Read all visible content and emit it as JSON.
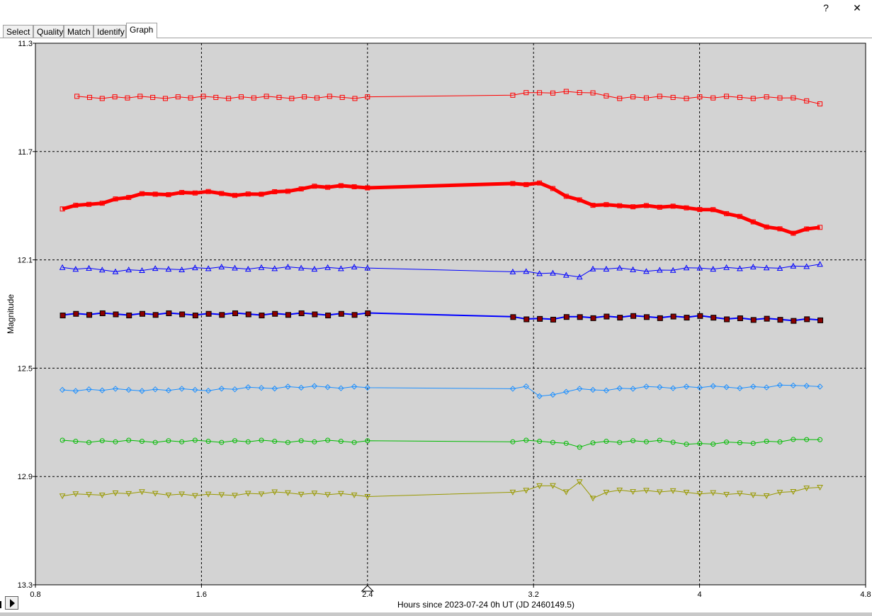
{
  "window": {
    "help_label": "?",
    "close_label": "✕"
  },
  "tabs": [
    {
      "label": "Select",
      "active": false
    },
    {
      "label": "Quality",
      "active": false
    },
    {
      "label": "Match",
      "active": false
    },
    {
      "label": "Identify",
      "active": false
    },
    {
      "label": "Graph",
      "active": true
    }
  ],
  "chart_data": {
    "type": "scatter",
    "xlabel": "Hours since 2023-07-24 0h UT (JD 2460149.5)",
    "ylabel": "Magnitude",
    "xlim": [
      0.8,
      4.8
    ],
    "ylim": [
      13.3,
      11.3
    ],
    "y_inverted": true,
    "xticks": [
      "0.8",
      "1.6",
      "2.4",
      "3.2",
      "4",
      "4.8"
    ],
    "yticks": [
      "11.3",
      "11.7",
      "12.1",
      "12.5",
      "12.9",
      "13.3"
    ],
    "grid": true,
    "plot_background": "#d3d3d3",
    "time_marker_x": 2.4,
    "gap": [
      2.4,
      3.1
    ],
    "series": [
      {
        "color": "#ff0000",
        "marker": "square",
        "line_width": 1,
        "points": 48,
        "keypoints": [
          [
            1.0,
            11.5
          ],
          [
            1.5,
            11.5
          ],
          [
            2.1,
            11.5
          ],
          [
            2.4,
            11.5
          ],
          [
            3.1,
            11.49
          ],
          [
            3.28,
            11.48
          ],
          [
            3.42,
            11.48
          ],
          [
            3.6,
            11.5
          ],
          [
            4.0,
            11.5
          ],
          [
            4.4,
            11.5
          ],
          [
            4.58,
            11.52
          ]
        ]
      },
      {
        "color": "#ff0000",
        "marker": "square",
        "line_width": 5,
        "points": 48,
        "keypoints": [
          [
            0.93,
            11.91
          ],
          [
            1.1,
            11.89
          ],
          [
            1.3,
            11.86
          ],
          [
            1.6,
            11.85
          ],
          [
            1.8,
            11.86
          ],
          [
            2.0,
            11.85
          ],
          [
            2.1,
            11.83
          ],
          [
            2.4,
            11.83
          ],
          [
            3.1,
            11.82
          ],
          [
            3.25,
            11.82
          ],
          [
            3.38,
            11.87
          ],
          [
            3.5,
            11.9
          ],
          [
            3.7,
            11.9
          ],
          [
            4.0,
            11.91
          ],
          [
            4.1,
            11.92
          ],
          [
            4.3,
            11.97
          ],
          [
            4.45,
            12.0
          ],
          [
            4.58,
            11.98
          ]
        ]
      },
      {
        "color": "#0000ff",
        "marker": "triangle-up",
        "line_width": 1,
        "points": 48,
        "keypoints": [
          [
            0.93,
            12.13
          ],
          [
            1.2,
            12.14
          ],
          [
            1.6,
            12.13
          ],
          [
            2.0,
            12.13
          ],
          [
            2.4,
            12.13
          ],
          [
            3.1,
            12.14
          ],
          [
            3.25,
            12.15
          ],
          [
            3.42,
            12.16
          ],
          [
            3.5,
            12.13
          ],
          [
            3.8,
            12.14
          ],
          [
            4.0,
            12.13
          ],
          [
            4.3,
            12.13
          ],
          [
            4.58,
            12.12
          ]
        ]
      },
      {
        "color": "#0000ff",
        "marker": "square-filled",
        "line_width": 2,
        "points": 48,
        "keypoints": [
          [
            0.93,
            12.3
          ],
          [
            1.2,
            12.3
          ],
          [
            1.6,
            12.3
          ],
          [
            2.0,
            12.3
          ],
          [
            2.4,
            12.3
          ],
          [
            3.1,
            12.31
          ],
          [
            3.25,
            12.32
          ],
          [
            3.42,
            12.31
          ],
          [
            3.8,
            12.31
          ],
          [
            4.0,
            12.31
          ],
          [
            4.3,
            12.32
          ],
          [
            4.58,
            12.32
          ]
        ]
      },
      {
        "color": "#1e90ff",
        "marker": "diamond",
        "line_width": 1,
        "points": 48,
        "keypoints": [
          [
            0.93,
            12.58
          ],
          [
            1.3,
            12.58
          ],
          [
            1.6,
            12.58
          ],
          [
            2.0,
            12.57
          ],
          [
            2.4,
            12.57
          ],
          [
            3.1,
            12.58
          ],
          [
            3.15,
            12.56
          ],
          [
            3.25,
            12.61
          ],
          [
            3.38,
            12.58
          ],
          [
            3.5,
            12.58
          ],
          [
            3.8,
            12.57
          ],
          [
            4.0,
            12.57
          ],
          [
            4.3,
            12.57
          ],
          [
            4.55,
            12.56
          ],
          [
            4.58,
            12.57
          ]
        ]
      },
      {
        "color": "#00bb00",
        "marker": "circle",
        "line_width": 1,
        "points": 48,
        "keypoints": [
          [
            0.93,
            12.77
          ],
          [
            1.3,
            12.77
          ],
          [
            1.6,
            12.77
          ],
          [
            2.0,
            12.77
          ],
          [
            2.4,
            12.77
          ],
          [
            3.1,
            12.77
          ],
          [
            3.3,
            12.77
          ],
          [
            3.42,
            12.79
          ],
          [
            3.55,
            12.77
          ],
          [
            3.8,
            12.77
          ],
          [
            4.0,
            12.78
          ],
          [
            4.4,
            12.77
          ],
          [
            4.58,
            12.76
          ]
        ]
      },
      {
        "color": "#999900",
        "marker": "triangle-down",
        "line_width": 1,
        "points": 48,
        "keypoints": [
          [
            0.93,
            12.97
          ],
          [
            1.3,
            12.96
          ],
          [
            1.6,
            12.97
          ],
          [
            2.0,
            12.96
          ],
          [
            2.4,
            12.97
          ],
          [
            3.1,
            12.96
          ],
          [
            3.28,
            12.93
          ],
          [
            3.38,
            12.96
          ],
          [
            3.42,
            12.92
          ],
          [
            3.48,
            12.98
          ],
          [
            3.6,
            12.95
          ],
          [
            4.0,
            12.96
          ],
          [
            4.3,
            12.97
          ],
          [
            4.58,
            12.94
          ]
        ]
      }
    ]
  }
}
